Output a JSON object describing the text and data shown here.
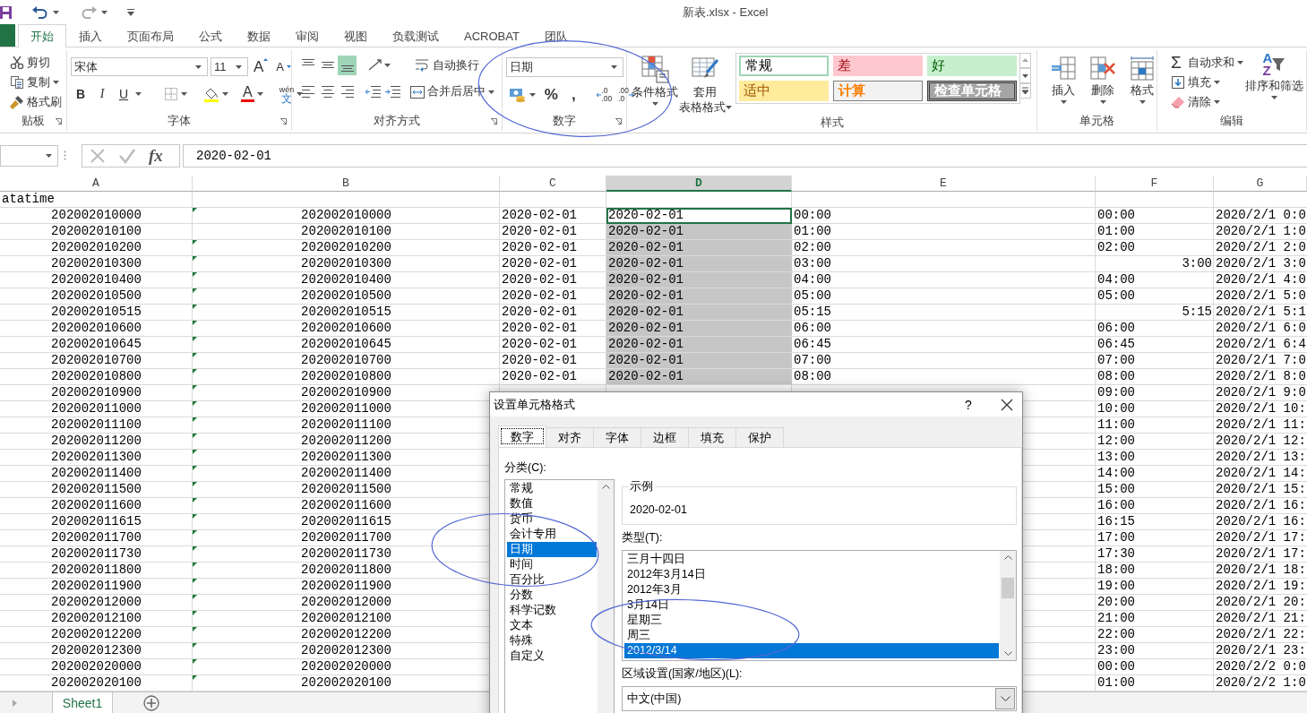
{
  "title_bar": {
    "title": "新表.xlsx - Excel"
  },
  "ribbon_tabs": [
    {
      "label": "开始",
      "selected": true
    },
    {
      "label": "插入",
      "selected": false
    },
    {
      "label": "页面布局",
      "selected": false
    },
    {
      "label": "公式",
      "selected": false
    },
    {
      "label": "数据",
      "selected": false
    },
    {
      "label": "审阅",
      "selected": false
    },
    {
      "label": "视图",
      "selected": false
    },
    {
      "label": "负载测试",
      "selected": false
    },
    {
      "label": "ACROBAT",
      "selected": false
    },
    {
      "label": "团队",
      "selected": false
    }
  ],
  "ribbon": {
    "groups": [
      {
        "kind": "clipboard",
        "label": "贴板",
        "buttons": [
          {
            "kind": "cut",
            "label": "剪切"
          },
          {
            "kind": "copy",
            "label": "复制"
          },
          {
            "kind": "painter",
            "label": "格式刷"
          }
        ]
      },
      {
        "kind": "font",
        "label": "字体",
        "font_name": "宋体",
        "font_size": "11",
        "grow_font": "A",
        "shrink_font": "A",
        "format_buttons": [
          "B",
          "I",
          "U"
        ],
        "font_color": "A",
        "phonetic_guide": "wén",
        "phonetic_char": "文"
      },
      {
        "kind": "alignment",
        "label": "对齐方式",
        "vertical_align": [
          {
            "selected": false
          },
          {
            "selected": false
          },
          {
            "selected": true
          }
        ],
        "wrap_text": "自动换行",
        "merge": "合并后居中"
      },
      {
        "kind": "number",
        "label": "数字",
        "format": "日期",
        "percent": "%",
        "comma": ",",
        "increase_decimal": [
          ".0",
          ".00"
        ],
        "decrease_decimal": [
          ".00",
          ".0"
        ]
      },
      {
        "kind": "styles",
        "label": "样式",
        "conditional": "条件格式",
        "table_format": [
          "套用",
          "表格格式"
        ],
        "gallery": [
          {
            "kind": "normal",
            "label": "常规"
          },
          {
            "kind": "bad",
            "label": "差"
          },
          {
            "kind": "good",
            "label": "好"
          },
          {
            "kind": "neutral",
            "label": "适中"
          },
          {
            "kind": "calculation",
            "label": "计算"
          },
          {
            "kind": "check",
            "label": "检查单元格"
          }
        ]
      },
      {
        "kind": "cells",
        "label": "单元格",
        "buttons": [
          {
            "kind": "insert",
            "label": "插入"
          },
          {
            "kind": "delete",
            "label": "删除"
          },
          {
            "kind": "format",
            "label": "格式"
          }
        ]
      },
      {
        "kind": "editing",
        "label": "编辑",
        "autosum_symbol": "Σ",
        "buttons": [
          {
            "kind": "autosum",
            "label": "自动求和"
          },
          {
            "kind": "fill",
            "label": "填充"
          },
          {
            "kind": "clear",
            "label": "清除"
          }
        ],
        "sort_letters": [
          "A",
          "Z"
        ],
        "sort": "排序和筛选"
      }
    ]
  },
  "formula_bar": {
    "function_label": "fx",
    "value": "2020-02-01"
  },
  "sheet": {
    "columns": [
      {
        "label": "A",
        "selected": false
      },
      {
        "label": "B",
        "selected": false
      },
      {
        "label": "C",
        "selected": false
      },
      {
        "label": "D",
        "selected": true
      },
      {
        "label": "E",
        "selected": false
      },
      {
        "label": "F",
        "selected": false
      },
      {
        "label": "G",
        "selected": false
      }
    ],
    "rows": [
      {
        "kind": "header",
        "a": "atatime"
      },
      {
        "kind": "data",
        "a": "202002010000",
        "b": "202002010000",
        "b_flag": true,
        "c": "2020-02-01",
        "d": "2020-02-01",
        "d_active": true,
        "e": "00:00",
        "f": "00:00",
        "f_numeric": false,
        "g": "2020/2/1 0:0"
      },
      {
        "kind": "data",
        "a": "202002010100",
        "b": "202002010100",
        "b_flag": false,
        "c": "2020-02-01",
        "d": "2020-02-01",
        "d_selected": true,
        "d_active": false,
        "e": "01:00",
        "f": "01:00",
        "f_numeric": false,
        "g": "2020/2/1 1:0"
      },
      {
        "kind": "data",
        "a": "202002010200",
        "b": "202002010200",
        "b_flag": true,
        "c": "2020-02-01",
        "d": "2020-02-01",
        "d_selected": true,
        "d_active": false,
        "e": "02:00",
        "f": "02:00",
        "f_numeric": false,
        "g": "2020/2/1 2:0"
      },
      {
        "kind": "data",
        "a": "202002010300",
        "b": "202002010300",
        "b_flag": true,
        "c": "2020-02-01",
        "d": "2020-02-01",
        "d_selected": true,
        "d_active": false,
        "e": "03:00",
        "f": "3:00",
        "f_numeric": true,
        "g": "2020/2/1 3:0"
      },
      {
        "kind": "data",
        "a": "202002010400",
        "b": "202002010400",
        "b_flag": true,
        "c": "2020-02-01",
        "d": "2020-02-01",
        "d_selected": true,
        "d_active": false,
        "e": "04:00",
        "f": "04:00",
        "f_numeric": false,
        "g": "2020/2/1 4:0"
      },
      {
        "kind": "data",
        "a": "202002010500",
        "b": "202002010500",
        "b_flag": true,
        "c": "2020-02-01",
        "d": "2020-02-01",
        "d_selected": true,
        "d_active": false,
        "e": "05:00",
        "f": "05:00",
        "f_numeric": false,
        "g": "2020/2/1 5:0"
      },
      {
        "kind": "data",
        "a": "202002010515",
        "b": "202002010515",
        "b_flag": true,
        "c": "2020-02-01",
        "d": "2020-02-01",
        "d_selected": true,
        "d_active": false,
        "e": "05:15",
        "f": "5:15",
        "f_numeric": true,
        "g": "2020/2/1 5:1"
      },
      {
        "kind": "data",
        "a": "202002010600",
        "b": "202002010600",
        "b_flag": true,
        "c": "2020-02-01",
        "d": "2020-02-01",
        "d_selected": true,
        "d_active": false,
        "e": "06:00",
        "f": "06:00",
        "f_numeric": false,
        "g": "2020/2/1 6:0"
      },
      {
        "kind": "data",
        "a": "202002010645",
        "b": "202002010645",
        "b_flag": true,
        "c": "2020-02-01",
        "d": "2020-02-01",
        "d_selected": true,
        "d_active": false,
        "e": "06:45",
        "f": "06:45",
        "f_numeric": false,
        "g": "2020/2/1 6:4"
      },
      {
        "kind": "data",
        "a": "202002010700",
        "b": "202002010700",
        "b_flag": true,
        "c": "2020-02-01",
        "d": "2020-02-01",
        "d_selected": true,
        "d_active": false,
        "e": "07:00",
        "f": "07:00",
        "f_numeric": false,
        "g": "2020/2/1 7:0"
      },
      {
        "kind": "data",
        "a": "202002010800",
        "b": "202002010800",
        "b_flag": true,
        "c": "2020-02-01",
        "d": "2020-02-01",
        "d_selected": true,
        "d_active": false,
        "e": "08:00",
        "f": "08:00",
        "f_numeric": false,
        "g": "2020/2/1 8:0"
      },
      {
        "kind": "data",
        "a": "202002010900",
        "b": "202002010900",
        "b_flag": true,
        "f": "09:00",
        "f_numeric": false,
        "g": "2020/2/1 9:0"
      },
      {
        "kind": "data",
        "a": "202002011000",
        "b": "202002011000",
        "b_flag": true,
        "f": "10:00",
        "f_numeric": false,
        "g": "2020/2/1 10:"
      },
      {
        "kind": "data",
        "a": "202002011100",
        "b": "202002011100",
        "b_flag": true,
        "f": "11:00",
        "f_numeric": false,
        "g": "2020/2/1 11:"
      },
      {
        "kind": "data",
        "a": "202002011200",
        "b": "202002011200",
        "b_flag": true,
        "f": "12:00",
        "f_numeric": false,
        "g": "2020/2/1 12:"
      },
      {
        "kind": "data",
        "a": "202002011300",
        "b": "202002011300",
        "b_flag": true,
        "f": "13:00",
        "f_numeric": false,
        "g": "2020/2/1 13:"
      },
      {
        "kind": "data",
        "a": "202002011400",
        "b": "202002011400",
        "b_flag": true,
        "f": "14:00",
        "f_numeric": false,
        "g": "2020/2/1 14:"
      },
      {
        "kind": "data",
        "a": "202002011500",
        "b": "202002011500",
        "b_flag": true,
        "f": "15:00",
        "f_numeric": false,
        "g": "2020/2/1 15:"
      },
      {
        "kind": "data",
        "a": "202002011600",
        "b": "202002011600",
        "b_flag": true,
        "f": "16:00",
        "f_numeric": false,
        "g": "2020/2/1 16:"
      },
      {
        "kind": "data",
        "a": "202002011615",
        "b": "202002011615",
        "b_flag": true,
        "f": "16:15",
        "f_numeric": false,
        "g": "2020/2/1 16:"
      },
      {
        "kind": "data",
        "a": "202002011700",
        "b": "202002011700",
        "b_flag": true,
        "f": "17:00",
        "f_numeric": false,
        "g": "2020/2/1 17:"
      },
      {
        "kind": "data",
        "a": "202002011730",
        "b": "202002011730",
        "b_flag": true,
        "f": "17:30",
        "f_numeric": false,
        "g": "2020/2/1 17:"
      },
      {
        "kind": "data",
        "a": "202002011800",
        "b": "202002011800",
        "b_flag": true,
        "f": "18:00",
        "f_numeric": false,
        "g": "2020/2/1 18:"
      },
      {
        "kind": "data",
        "a": "202002011900",
        "b": "202002011900",
        "b_flag": true,
        "f": "19:00",
        "f_numeric": false,
        "g": "2020/2/1 19:"
      },
      {
        "kind": "data",
        "a": "202002012000",
        "b": "202002012000",
        "b_flag": true,
        "f": "20:00",
        "f_numeric": false,
        "g": "2020/2/1 20:"
      },
      {
        "kind": "data",
        "a": "202002012100",
        "b": "202002012100",
        "b_flag": true,
        "f": "21:00",
        "f_numeric": false,
        "g": "2020/2/1 21:"
      },
      {
        "kind": "data",
        "a": "202002012200",
        "b": "202002012200",
        "b_flag": true,
        "f": "22:00",
        "f_numeric": false,
        "g": "2020/2/1 22:"
      },
      {
        "kind": "data",
        "a": "202002012300",
        "b": "202002012300",
        "b_flag": true,
        "f": "23:00",
        "f_numeric": false,
        "g": "2020/2/1 23:"
      },
      {
        "kind": "data",
        "a": "202002020000",
        "b": "202002020000",
        "b_flag": true,
        "f": "00:00",
        "f_numeric": false,
        "g": "2020/2/2 0:0"
      },
      {
        "kind": "data",
        "a": "202002020100",
        "b": "202002020100",
        "b_flag": true,
        "f": "01:00",
        "f_numeric": false,
        "g": "2020/2/2 1:0"
      }
    ]
  },
  "sheet_tabs": [
    {
      "label": "Sheet1",
      "selected": true
    }
  ],
  "dialog": {
    "title": "设置单元格格式",
    "help": "?",
    "tabs": [
      {
        "label": "数字",
        "selected": true
      },
      {
        "label": "对齐",
        "selected": false
      },
      {
        "label": "字体",
        "selected": false
      },
      {
        "label": "边框",
        "selected": false
      },
      {
        "label": "填充",
        "selected": false
      },
      {
        "label": "保护",
        "selected": false
      }
    ],
    "category_label": "分类(C):",
    "categories": [
      {
        "label": "常规",
        "selected": false
      },
      {
        "label": "数值",
        "selected": false
      },
      {
        "label": "货币",
        "selected": false
      },
      {
        "label": "会计专用",
        "selected": false
      },
      {
        "label": "日期",
        "selected": true
      },
      {
        "label": "时间",
        "selected": false
      },
      {
        "label": "百分比",
        "selected": false
      },
      {
        "label": "分数",
        "selected": false
      },
      {
        "label": "科学记数",
        "selected": false
      },
      {
        "label": "文本",
        "selected": false
      },
      {
        "label": "特殊",
        "selected": false
      },
      {
        "label": "自定义",
        "selected": false
      }
    ],
    "sample_label": "示例",
    "sample": "2020-02-01",
    "type_label": "类型(T):",
    "types": [
      {
        "label": "三月十四日",
        "selected": false
      },
      {
        "label": "2012年3月14日",
        "selected": false
      },
      {
        "label": "2012年3月",
        "selected": false
      },
      {
        "label": "3月14日",
        "selected": false
      },
      {
        "label": "星期三",
        "selected": false
      },
      {
        "label": "周三",
        "selected": false
      },
      {
        "label": "2012/3/14",
        "selected": true
      }
    ],
    "locale_label": "区域设置(国家/地区)(L):",
    "locale": "中文(中国)"
  }
}
